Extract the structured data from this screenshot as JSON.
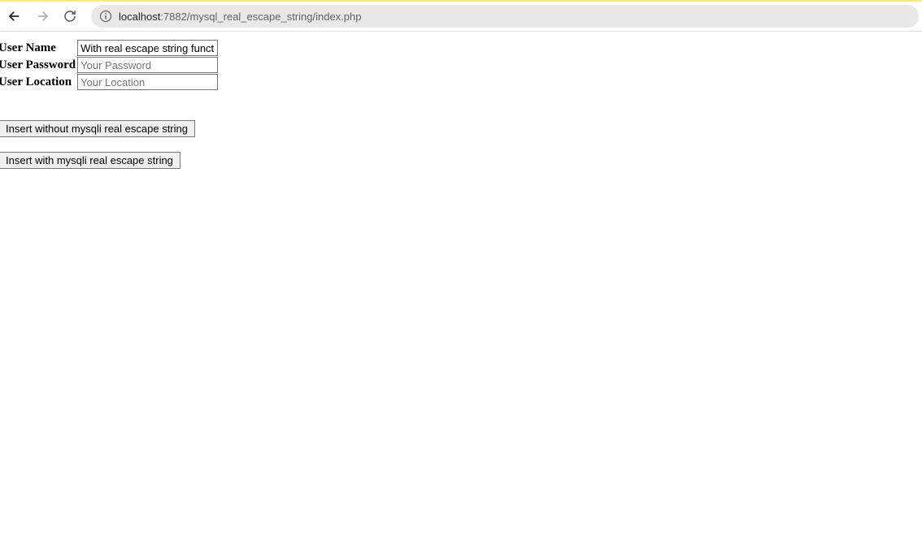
{
  "browser": {
    "url_host": "localhost",
    "url_path": ":7882/mysql_real_escape_string/index.php"
  },
  "form": {
    "name_label": "User Name",
    "name_value": "With real escape string funct",
    "password_label": "User Password",
    "password_placeholder": "Your Password",
    "location_label": "User Location",
    "location_placeholder": "Your Location"
  },
  "buttons": {
    "insert_without": "Insert without mysqli real escape string",
    "insert_with": "Insert with mysqli real escape string"
  }
}
